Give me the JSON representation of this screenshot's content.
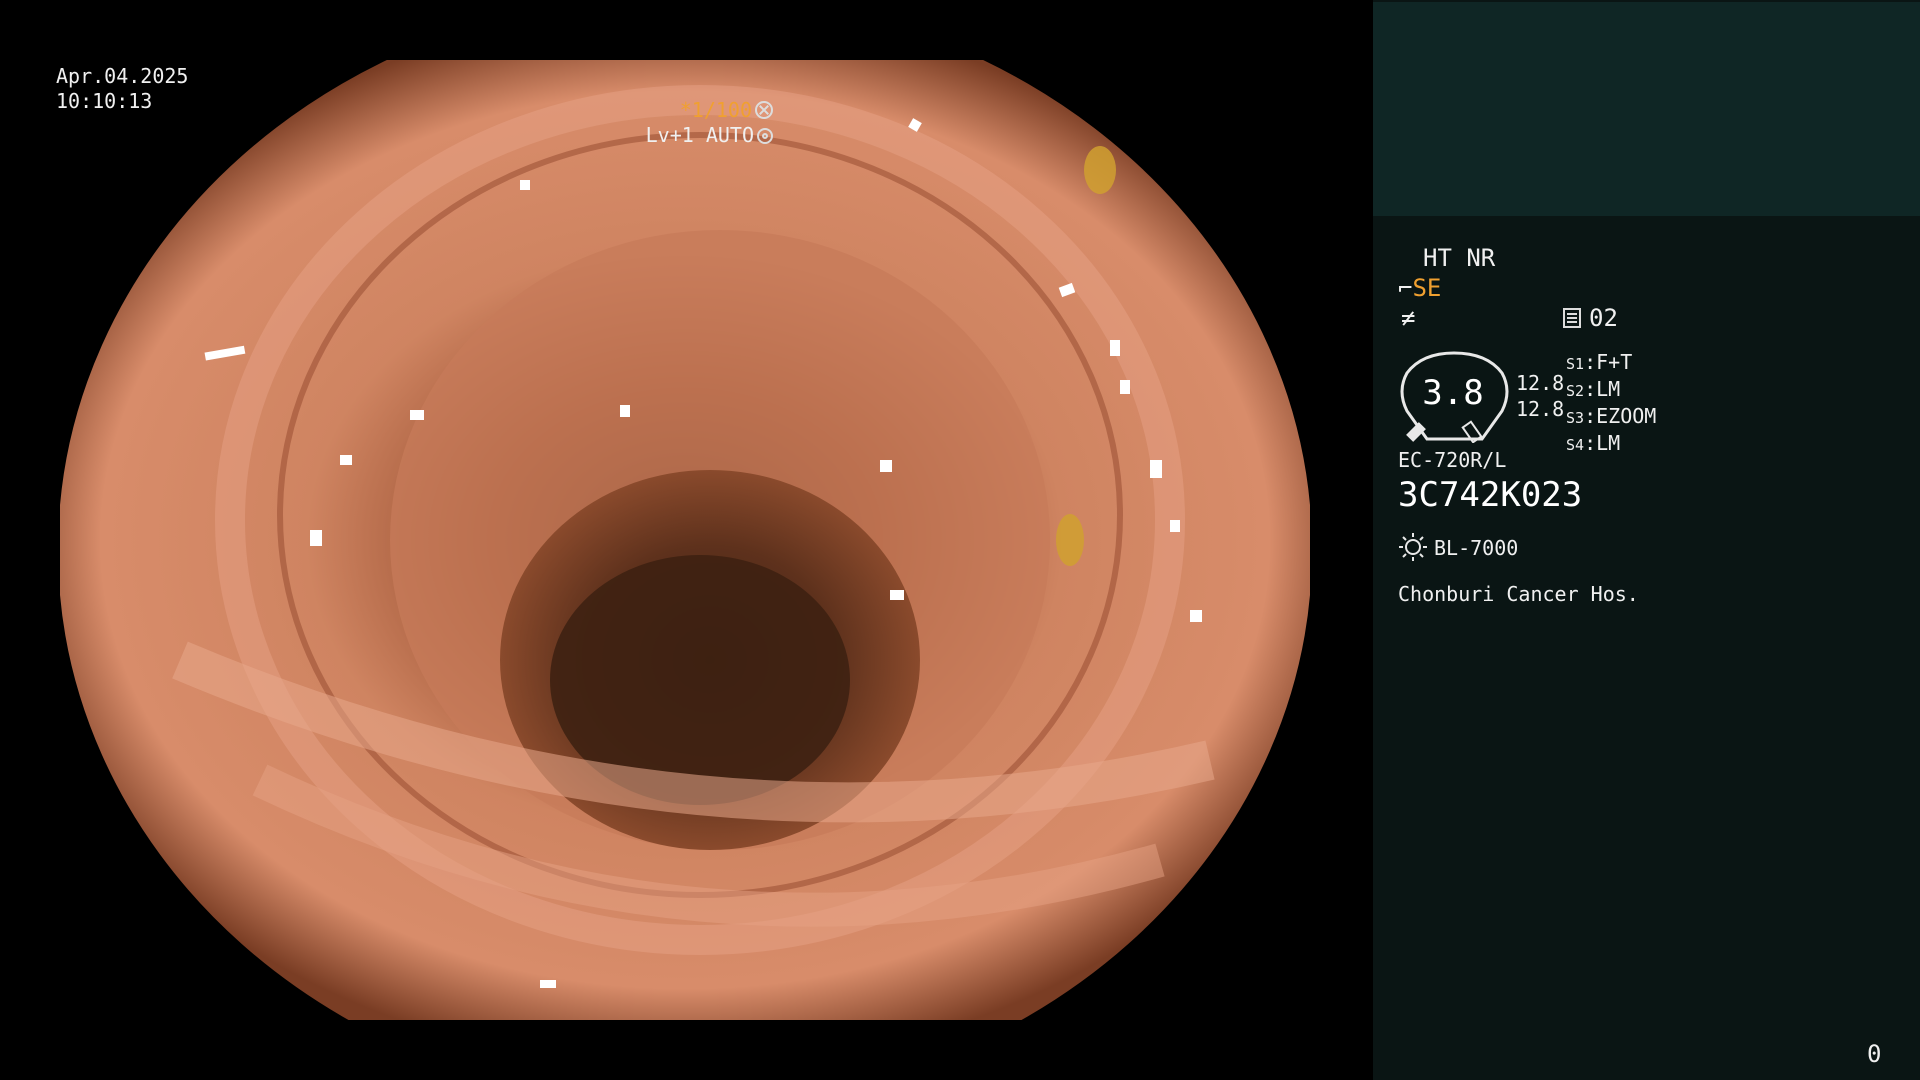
{
  "overlay": {
    "date": "Apr.04.2025",
    "time": "10:10:13",
    "shutter": "*1/100",
    "level_mode": "Lv+1 AUTO"
  },
  "panel": {
    "mode": "HT NR",
    "structure_enhancement": "SE",
    "ff_symbol": "≠",
    "memory": "02",
    "zoom_ratio": "3.8",
    "zoom_values": [
      "12.8",
      "12.8"
    ],
    "scope_buttons": [
      {
        "key": "S1",
        "value": "F+T"
      },
      {
        "key": "S2",
        "value": "LM"
      },
      {
        "key": "S3",
        "value": "EZOOM"
      },
      {
        "key": "S4",
        "value": "LM"
      }
    ],
    "scope_model": "EC-720R/L",
    "serial_number": "3C742K023",
    "light_source": "BL-7000",
    "hospital": "Chonburi Cancer Hos.",
    "counter": "0"
  },
  "colors": {
    "accent": "#f0a030",
    "panel_bg": "#0a1514",
    "thumb_bg": "#0f2625",
    "mucosa": "#c97a5a"
  }
}
